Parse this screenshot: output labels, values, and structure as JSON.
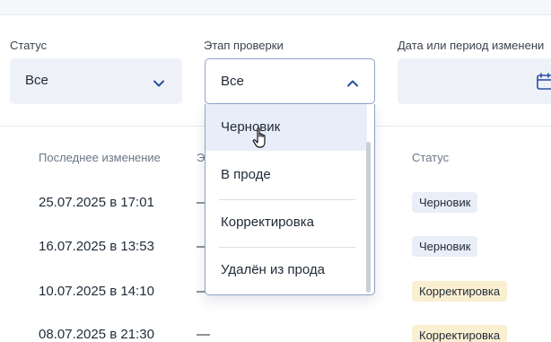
{
  "filters": {
    "status": {
      "label": "Статус",
      "value": "Все"
    },
    "stage": {
      "label": "Этап проверки",
      "value": "Все"
    },
    "date": {
      "label": "Дата или период изменени"
    }
  },
  "table": {
    "headers": {
      "last_change": "Последнее изменение",
      "stage_partial": "Э",
      "status": "Статус"
    },
    "rows": [
      {
        "date": "25.07.2025 в 17:01",
        "stage": "—",
        "status": "Черновик"
      },
      {
        "date": "16.07.2025 в 13:53",
        "stage": "—",
        "status": "Черновик"
      },
      {
        "date": "10.07.2025 в 14:10",
        "stage": "—",
        "status": "Корректировка"
      },
      {
        "date": "08.07.2025 в 21:30",
        "stage": "—",
        "status": "Корректировка"
      }
    ]
  },
  "dropdown": {
    "options": [
      "Черновик",
      "В проде",
      "Корректировка",
      "Удалён из прода"
    ],
    "highlighted": "Черновик"
  },
  "colors": {
    "accent": "#2b4fa0",
    "badge_draft": "#e9eef8",
    "badge_correction": "#fbefd2"
  },
  "icons": {
    "chevron_down": "chevron-down-icon",
    "chevron_up": "chevron-up-icon",
    "calendar": "calendar-icon",
    "cursor": "hand-pointer-icon"
  }
}
